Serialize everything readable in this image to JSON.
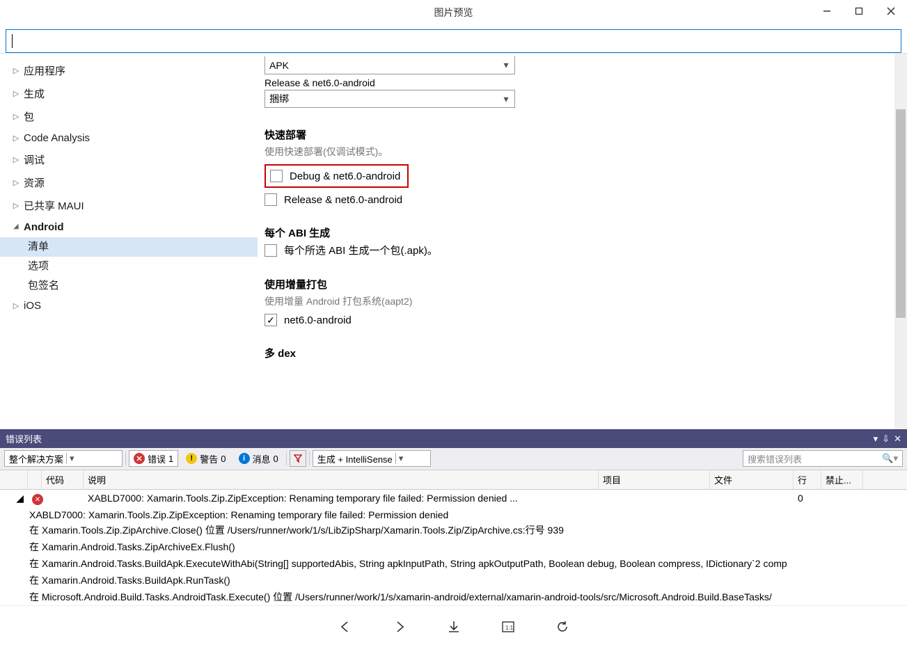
{
  "window": {
    "title": "图片预览"
  },
  "sidebar": {
    "items": [
      {
        "label": "应用程序"
      },
      {
        "label": "生成"
      },
      {
        "label": "包"
      },
      {
        "label": "Code Analysis"
      },
      {
        "label": "调试"
      },
      {
        "label": "资源"
      },
      {
        "label": "已共享 MAUI"
      }
    ],
    "android_label": "Android",
    "android_children": [
      "清单",
      "选项",
      "包签名"
    ],
    "ios_label": "iOS"
  },
  "content": {
    "apk_value": "APK",
    "release_label": "Release & net6.0-android",
    "bind_value": "捆绑",
    "sections": {
      "fastdeploy": {
        "heading": "快速部署",
        "desc": "使用快速部署(仅调试模式)。",
        "opt1": "Debug & net6.0-android",
        "opt2": "Release & net6.0-android"
      },
      "abi": {
        "heading": "每个 ABI 生成",
        "opt": "每个所选 ABI 生成一个包(.apk)。"
      },
      "incremental": {
        "heading": "使用增量打包",
        "desc": "使用增量 Android 打包系统(aapt2)",
        "opt": "net6.0-android"
      },
      "multidex": {
        "heading": "多 dex"
      }
    }
  },
  "errorlist": {
    "title": "错误列表",
    "scope": "整个解决方案",
    "errors_label": "错误",
    "errors_count": "1",
    "warnings_label": "警告",
    "warnings_count": "0",
    "messages_label": "消息",
    "messages_count": "0",
    "source": "生成 + IntelliSense",
    "search_placeholder": "搜索错误列表",
    "columns": {
      "code": "代码",
      "desc": "说明",
      "project": "项目",
      "file": "文件",
      "line": "行",
      "suppress": "禁止..."
    },
    "row": {
      "desc": "XABLD7000: Xamarin.Tools.Zip.ZipException: Renaming temporary file failed: Permission denied ...",
      "line": "0"
    },
    "detail": [
      "XABLD7000: Xamarin.Tools.Zip.ZipException: Renaming temporary file failed: Permission denied",
      "   在 Xamarin.Tools.Zip.ZipArchive.Close() 位置 /Users/runner/work/1/s/LibZipSharp/Xamarin.Tools.Zip/ZipArchive.cs:行号 939",
      "   在 Xamarin.Android.Tasks.ZipArchiveEx.Flush()",
      "   在 Xamarin.Android.Tasks.BuildApk.ExecuteWithAbi(String[] supportedAbis, String apkInputPath, String apkOutputPath, Boolean debug, Boolean compress, IDictionary`2 comp",
      "   在 Xamarin.Android.Tasks.BuildApk.RunTask()",
      "   在 Microsoft.Android.Build.Tasks.AndroidTask.Execute() 位置 /Users/runner/work/1/s/xamarin-android/external/xamarin-android-tools/src/Microsoft.Android.Build.BaseTasks/"
    ]
  }
}
